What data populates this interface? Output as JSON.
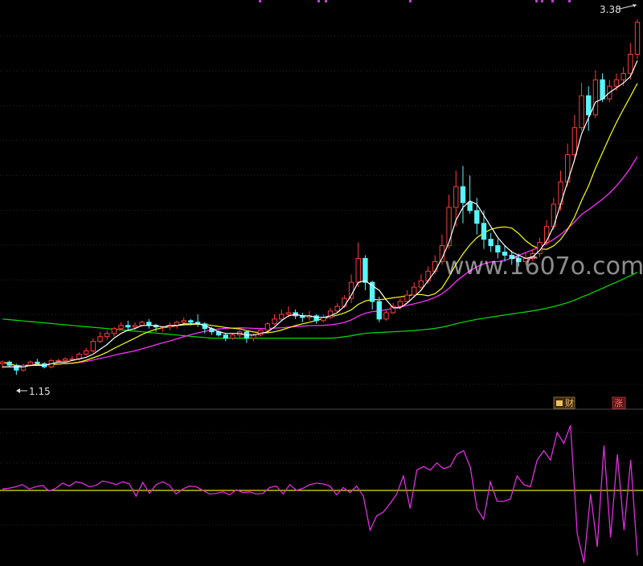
{
  "chart_data": [
    {
      "type": "candlestick",
      "ylim": [
        1.0,
        3.5
      ],
      "high_marker": {
        "label": "3.38",
        "value": 3.38
      },
      "low_marker": {
        "label": "1.15",
        "value": 1.15
      },
      "colors": {
        "up": "#ff3b3b",
        "down": "#54f7ff",
        "ma5": "#ffffff",
        "ma10": "#ffff00",
        "ma20": "#ff2dff",
        "ma60": "#00e000",
        "grid": "#262626"
      },
      "candles": [
        [
          1.24,
          1.25,
          1.21,
          1.26
        ],
        [
          1.25,
          1.23,
          1.22,
          1.26
        ],
        [
          1.23,
          1.2,
          1.17,
          1.24
        ],
        [
          1.2,
          1.23,
          1.19,
          1.24
        ],
        [
          1.23,
          1.25,
          1.22,
          1.26
        ],
        [
          1.25,
          1.24,
          1.23,
          1.27
        ],
        [
          1.24,
          1.22,
          1.21,
          1.25
        ],
        [
          1.22,
          1.26,
          1.21,
          1.27
        ],
        [
          1.26,
          1.26,
          1.25,
          1.27
        ],
        [
          1.26,
          1.27,
          1.25,
          1.28
        ],
        [
          1.27,
          1.27,
          1.26,
          1.29
        ],
        [
          1.27,
          1.3,
          1.26,
          1.31
        ],
        [
          1.3,
          1.32,
          1.29,
          1.34
        ],
        [
          1.32,
          1.38,
          1.31,
          1.4
        ],
        [
          1.38,
          1.41,
          1.37,
          1.44
        ],
        [
          1.41,
          1.43,
          1.39,
          1.45
        ],
        [
          1.43,
          1.46,
          1.41,
          1.47
        ],
        [
          1.46,
          1.48,
          1.45,
          1.5
        ],
        [
          1.48,
          1.47,
          1.45,
          1.51
        ],
        [
          1.47,
          1.48,
          1.45,
          1.5
        ],
        [
          1.48,
          1.5,
          1.47,
          1.51
        ],
        [
          1.5,
          1.48,
          1.46,
          1.52
        ],
        [
          1.48,
          1.47,
          1.44,
          1.49
        ],
        [
          1.47,
          1.47,
          1.44,
          1.48
        ],
        [
          1.47,
          1.48,
          1.45,
          1.5
        ],
        [
          1.48,
          1.5,
          1.46,
          1.51
        ],
        [
          1.5,
          1.51,
          1.49,
          1.53
        ],
        [
          1.51,
          1.5,
          1.48,
          1.52
        ],
        [
          1.5,
          1.49,
          1.47,
          1.55
        ],
        [
          1.49,
          1.46,
          1.43,
          1.5
        ],
        [
          1.46,
          1.44,
          1.42,
          1.47
        ],
        [
          1.44,
          1.42,
          1.41,
          1.45
        ],
        [
          1.42,
          1.4,
          1.38,
          1.43
        ],
        [
          1.4,
          1.42,
          1.39,
          1.43
        ],
        [
          1.42,
          1.44,
          1.4,
          1.45
        ],
        [
          1.44,
          1.4,
          1.37,
          1.45
        ],
        [
          1.4,
          1.42,
          1.38,
          1.43
        ],
        [
          1.42,
          1.45,
          1.41,
          1.46
        ],
        [
          1.45,
          1.49,
          1.44,
          1.5
        ],
        [
          1.49,
          1.52,
          1.48,
          1.55
        ],
        [
          1.52,
          1.55,
          1.51,
          1.58
        ],
        [
          1.55,
          1.56,
          1.53,
          1.6
        ],
        [
          1.56,
          1.54,
          1.52,
          1.58
        ],
        [
          1.54,
          1.53,
          1.5,
          1.56
        ],
        [
          1.53,
          1.54,
          1.51,
          1.57
        ],
        [
          1.54,
          1.51,
          1.49,
          1.55
        ],
        [
          1.51,
          1.53,
          1.5,
          1.55
        ],
        [
          1.53,
          1.57,
          1.52,
          1.59
        ],
        [
          1.57,
          1.6,
          1.56,
          1.62
        ],
        [
          1.6,
          1.65,
          1.59,
          1.67
        ],
        [
          1.65,
          1.75,
          1.62,
          1.8
        ],
        [
          1.75,
          1.9,
          1.72,
          2.0
        ],
        [
          1.9,
          1.75,
          1.7,
          1.92
        ],
        [
          1.75,
          1.63,
          1.58,
          1.76
        ],
        [
          1.63,
          1.52,
          1.5,
          1.66
        ],
        [
          1.52,
          1.56,
          1.51,
          1.58
        ],
        [
          1.56,
          1.6,
          1.55,
          1.62
        ],
        [
          1.6,
          1.63,
          1.58,
          1.65
        ],
        [
          1.63,
          1.67,
          1.62,
          1.7
        ],
        [
          1.67,
          1.72,
          1.66,
          1.75
        ],
        [
          1.72,
          1.76,
          1.7,
          1.8
        ],
        [
          1.76,
          1.82,
          1.74,
          1.85
        ],
        [
          1.82,
          1.88,
          1.8,
          1.92
        ],
        [
          1.88,
          1.98,
          1.86,
          2.05
        ],
        [
          1.98,
          2.22,
          1.96,
          2.3
        ],
        [
          2.22,
          2.35,
          2.1,
          2.45
        ],
        [
          2.35,
          2.25,
          2.12,
          2.48
        ],
        [
          2.25,
          2.2,
          2.18,
          2.42
        ],
        [
          2.2,
          2.12,
          2.05,
          2.28
        ],
        [
          2.12,
          2.02,
          1.96,
          2.2
        ],
        [
          2.02,
          1.98,
          1.94,
          2.06
        ],
        [
          1.98,
          1.94,
          1.9,
          2.02
        ],
        [
          1.94,
          1.92,
          1.88,
          1.98
        ],
        [
          1.92,
          1.9,
          1.86,
          1.95
        ],
        [
          1.9,
          1.88,
          1.85,
          1.93
        ],
        [
          1.88,
          1.9,
          1.86,
          1.94
        ],
        [
          1.9,
          1.93,
          1.88,
          1.96
        ],
        [
          1.93,
          2.0,
          1.91,
          2.03
        ],
        [
          2.0,
          2.1,
          1.98,
          2.14
        ],
        [
          2.1,
          2.24,
          2.08,
          2.28
        ],
        [
          2.24,
          2.38,
          2.2,
          2.45
        ],
        [
          2.38,
          2.55,
          2.35,
          2.62
        ],
        [
          2.55,
          2.72,
          2.52,
          2.8
        ],
        [
          2.72,
          2.92,
          2.7,
          3.0
        ],
        [
          2.92,
          2.8,
          2.7,
          2.98
        ],
        [
          2.8,
          3.02,
          2.78,
          3.08
        ],
        [
          3.02,
          2.9,
          2.88,
          3.06
        ],
        [
          2.9,
          2.98,
          2.88,
          3.02
        ],
        [
          2.98,
          3.02,
          2.95,
          3.06
        ],
        [
          3.02,
          3.06,
          2.98,
          3.1
        ],
        [
          3.06,
          3.18,
          3.02,
          3.25
        ],
        [
          3.18,
          3.38,
          3.15,
          3.4
        ]
      ],
      "ma5": [
        1.22,
        1.22,
        1.22,
        1.22,
        1.23,
        1.23,
        1.23,
        1.24,
        1.25,
        1.25,
        1.26,
        1.27,
        1.28,
        1.3,
        1.33,
        1.36,
        1.4,
        1.43,
        1.45,
        1.46,
        1.48,
        1.48,
        1.48,
        1.47,
        1.48,
        1.48,
        1.49,
        1.49,
        1.49,
        1.48,
        1.46,
        1.44,
        1.43,
        1.43,
        1.43,
        1.42,
        1.42,
        1.43,
        1.44,
        1.47,
        1.51,
        1.54,
        1.55,
        1.54,
        1.54,
        1.53,
        1.53,
        1.54,
        1.56,
        1.6,
        1.67,
        1.75,
        1.76,
        1.73,
        1.7,
        1.64,
        1.59,
        1.59,
        1.62,
        1.66,
        1.7,
        1.76,
        1.82,
        1.9,
        2.0,
        2.14,
        2.22,
        2.26,
        2.24,
        2.17,
        2.1,
        2.03,
        1.98,
        1.94,
        1.92,
        1.9,
        1.91,
        1.95,
        2.01,
        2.1,
        2.24,
        2.38,
        2.52,
        2.68,
        2.78,
        2.88,
        2.9,
        2.94,
        2.97,
        3.0,
        3.04,
        3.14
      ]
    },
    {
      "type": "line",
      "ylim": [
        -1,
        1
      ],
      "baseline": 0,
      "series": [
        {
          "values": [
            0.02,
            0.03,
            0.05,
            0.08,
            0.02,
            0.05,
            0.07,
            -0.01,
            0.03,
            0.1,
            0.06,
            0.12,
            0.1,
            0.05,
            0.07,
            0.13,
            0.11,
            0.08,
            0.12,
            0.09,
            -0.08,
            0.11,
            -0.04,
            0.08,
            0.12,
            0.07,
            -0.05,
            0.02,
            0.06,
            0.05,
            0.0,
            -0.05,
            -0.04,
            -0.02,
            -0.06,
            0.01,
            -0.03,
            -0.02,
            -0.05,
            -0.04,
            0.04,
            0.06,
            -0.05,
            0.08,
            0.0,
            0.03,
            0.08,
            0.1,
            0.09,
            0.06,
            -0.06,
            0.04,
            -0.03,
            0.06,
            -0.08,
            -0.55,
            -0.35,
            -0.3,
            -0.18,
            -0.05,
            0.2,
            -0.25,
            0.28,
            0.33,
            0.28,
            0.38,
            0.3,
            0.33,
            0.5,
            0.55,
            0.32,
            -0.25,
            -0.4,
            0.12,
            -0.15,
            -0.15,
            -0.12,
            0.2,
            0.08,
            0.05,
            0.42,
            0.55,
            0.42,
            0.8,
            0.65,
            0.9,
            -0.6,
            -1.0,
            -0.05,
            -0.78,
            0.62,
            -0.65,
            0.5,
            -0.55,
            0.42,
            -0.9
          ]
        }
      ]
    }
  ],
  "badges": {
    "finance_label": "财",
    "rise_label": "涨"
  },
  "watermark": "www.1607o.com"
}
